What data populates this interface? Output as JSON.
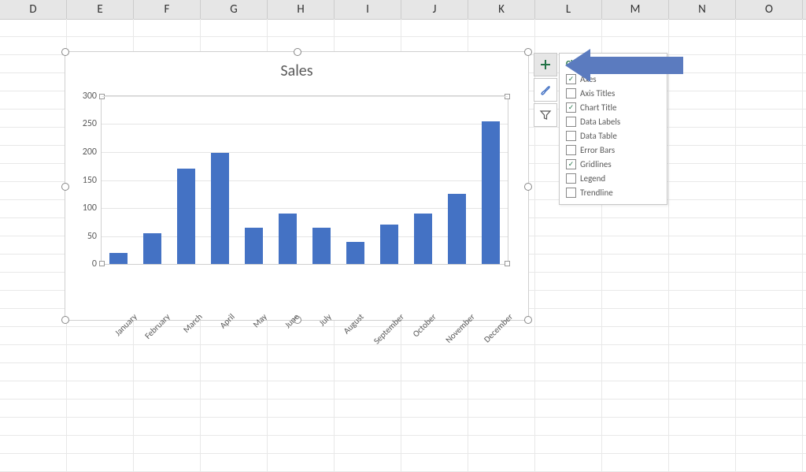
{
  "columns": [
    "D",
    "E",
    "F",
    "G",
    "H",
    "I",
    "J",
    "K",
    "L",
    "M",
    "N",
    "O"
  ],
  "chart_data": {
    "type": "bar",
    "title": "Sales",
    "categories": [
      "January",
      "February",
      "March",
      "April",
      "May",
      "June",
      "July",
      "August",
      "September",
      "October",
      "November",
      "December"
    ],
    "values": [
      20,
      55,
      170,
      198,
      65,
      90,
      65,
      40,
      70,
      90,
      125,
      255
    ],
    "ylim": [
      0,
      300
    ],
    "ystep": 50,
    "xlabel": "",
    "ylabel": ""
  },
  "side_buttons": {
    "elements": "plus-icon",
    "styles": "brush-icon",
    "filter": "funnel-icon"
  },
  "flyout": {
    "title": "Chart Elements",
    "items": [
      {
        "label": "Axes",
        "checked": true
      },
      {
        "label": "Axis Titles",
        "checked": false
      },
      {
        "label": "Chart Title",
        "checked": true
      },
      {
        "label": "Data Labels",
        "checked": false
      },
      {
        "label": "Data Table",
        "checked": false
      },
      {
        "label": "Error Bars",
        "checked": false
      },
      {
        "label": "Gridlines",
        "checked": true
      },
      {
        "label": "Legend",
        "checked": false
      },
      {
        "label": "Trendline",
        "checked": false
      }
    ]
  }
}
